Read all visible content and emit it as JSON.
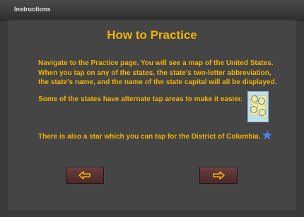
{
  "topbar": {
    "title": "Instructions"
  },
  "main": {
    "heading": "How to Practice",
    "paragraph1": "Navigate to the Practice page. You will see a map of the United States. When you tap on any of the states, the state's two-letter abbreviation, the state's name, and the name of the state capital will all be displayed.",
    "paragraph2": "Some of the states have alternate tap areas to make it easier.",
    "paragraph3": "There is also a star which you can tap for the District of Columbia."
  },
  "icons": {
    "map_thumbnail": "map-icon",
    "star": "star-icon",
    "back": "arrow-left-icon",
    "next": "arrow-right-icon"
  },
  "colors": {
    "accent_text": "#f2b400",
    "star": "#4a7fe0",
    "button": "#5a3232"
  }
}
